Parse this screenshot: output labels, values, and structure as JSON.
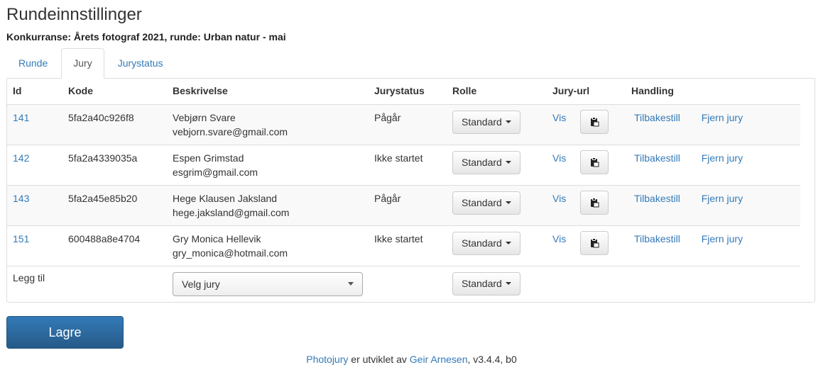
{
  "page": {
    "title": "Rundeinnstillinger",
    "subtitle": "Konkurranse: Årets fotograf 2021, runde: Urban natur - mai"
  },
  "tabs": [
    {
      "label": "Runde"
    },
    {
      "label": "Jury"
    },
    {
      "label": "Jurystatus"
    }
  ],
  "table": {
    "headers": {
      "id": "Id",
      "kode": "Kode",
      "beskrivelse": "Beskrivelse",
      "jurystatus": "Jurystatus",
      "rolle": "Rolle",
      "juryurl": "Jury-url",
      "handling": "Handling"
    },
    "rows": [
      {
        "id": "141",
        "kode": "5fa2a40c926f8",
        "name": "Vebjørn Svare",
        "email": "vebjorn.svare@gmail.com",
        "status": "Pågår",
        "rolle": "Standard",
        "vis": "Vis",
        "reset": "Tilbakestill",
        "remove": "Fjern jury"
      },
      {
        "id": "142",
        "kode": "5fa2a4339035a",
        "name": "Espen Grimstad",
        "email": "esgrim@gmail.com",
        "status": "Ikke startet",
        "rolle": "Standard",
        "vis": "Vis",
        "reset": "Tilbakestill",
        "remove": "Fjern jury"
      },
      {
        "id": "143",
        "kode": "5fa2a45e85b20",
        "name": "Hege Klausen Jaksland",
        "email": "hege.jaksland@gmail.com",
        "status": "Pågår",
        "rolle": "Standard",
        "vis": "Vis",
        "reset": "Tilbakestill",
        "remove": "Fjern jury"
      },
      {
        "id": "151",
        "kode": "600488a8e4704",
        "name": "Gry Monica Hellevik",
        "email": "gry_monica@hotmail.com",
        "status": "Ikke startet",
        "rolle": "Standard",
        "vis": "Vis",
        "reset": "Tilbakestill",
        "remove": "Fjern jury"
      }
    ],
    "add_row": {
      "label": "Legg til",
      "select_value": "Velg jury",
      "rolle": "Standard"
    }
  },
  "actions": {
    "save_label": "Lagre"
  },
  "footer": {
    "app_link": "Photojury",
    "middle": " er utviklet av ",
    "author_link": "Geir Arnesen",
    "version": ", v3.4.4, b0"
  },
  "icons": {
    "copy": "clipboard-icon",
    "caret": "caret-down-icon"
  },
  "colors": {
    "link": "#337ab7",
    "primary": "#2a6aa6"
  }
}
